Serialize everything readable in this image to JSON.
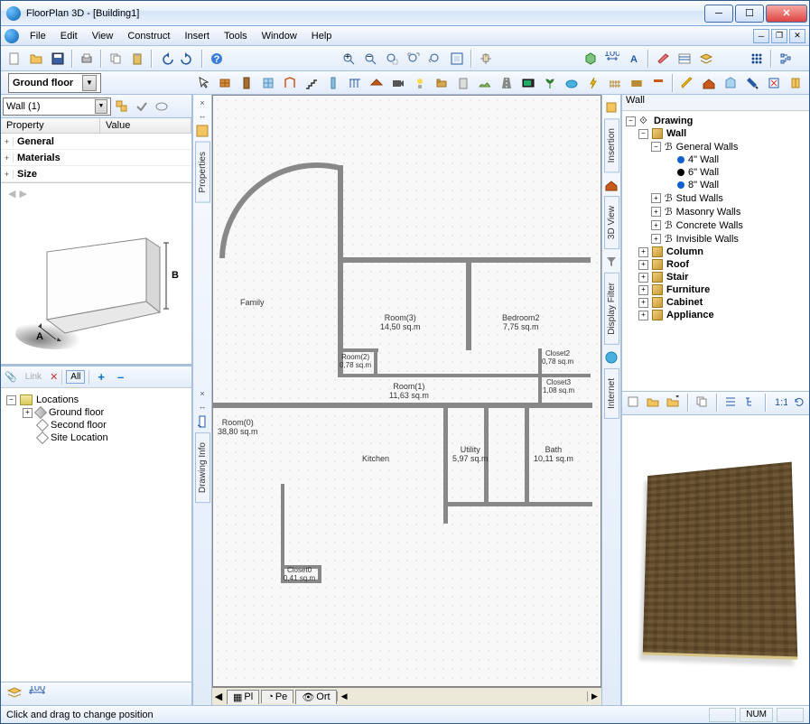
{
  "titlebar": {
    "app": "FloorPlan 3D",
    "doc": "[Building1]"
  },
  "menu": [
    "File",
    "Edit",
    "View",
    "Construct",
    "Insert",
    "Tools",
    "Window",
    "Help"
  ],
  "floor_selector": "Ground floor",
  "property_panel": {
    "object_selector": "Wall (1)",
    "columns": [
      "Property",
      "Value"
    ],
    "groups": [
      "General",
      "Materials",
      "Size"
    ]
  },
  "locations_panel": {
    "toolbar": {
      "link": "Link",
      "all": "All",
      "plus": "+",
      "minus": "–"
    },
    "root": "Locations",
    "children": [
      "Ground floor",
      "Second floor",
      "Site Location"
    ]
  },
  "side_tabs_left": {
    "tab1": "Properties",
    "tab2": "Drawing Info"
  },
  "side_tabs_mid": {
    "t1": "Insertion",
    "t2": "3D View",
    "t3": "Display Filter",
    "t4": "Internet"
  },
  "canvas": {
    "rooms": {
      "family": "Family",
      "room3": "Room(3)\n14,50 sq.m",
      "bedroom2": "Bedroom2\n7,75 sq.m",
      "room2": "Room(2)\n0,78 sq.m",
      "closet2": "Closet2\n0,78 sq.m",
      "room1": "Room(1)\n11,63 sq.m",
      "closet3": "Closet3\n1,08 sq.m",
      "room0": "Room(0)\n38,80 sq.m",
      "kitchen": "Kitchen",
      "utility": "Utility\n5,97 sq.m",
      "bath": "Bath\n10,11 sq.m",
      "closet0": "Closet0\n0,41 sq.m"
    },
    "tabs": [
      "Pl",
      "Pe",
      "Ort"
    ]
  },
  "catalog": {
    "title": "Wall",
    "root": "Drawing",
    "wall": "Wall",
    "general_walls": "General Walls",
    "wall4": "4\" Wall",
    "wall6": "6\" Wall",
    "wall8": "8\" Wall",
    "stud": "Stud Walls",
    "masonry": "Masonry Walls",
    "concrete": "Concrete Walls",
    "invisible": "Invisible Walls",
    "column": "Column",
    "roof": "Roof",
    "stair": "Stair",
    "furniture": "Furniture",
    "cabinet": "Cabinet",
    "appliance": "Appliance"
  },
  "statusbar": {
    "hint": "Click and drag to change position",
    "num": "NUM"
  }
}
